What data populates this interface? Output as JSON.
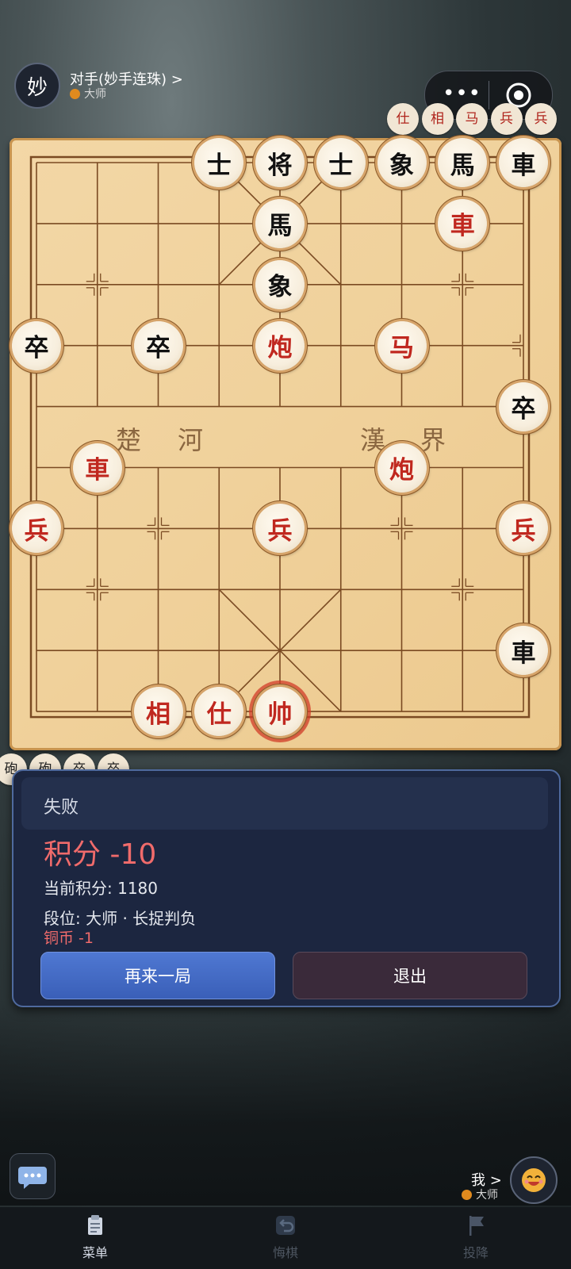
{
  "opponent": {
    "avatar_char": "妙",
    "name": "对手(妙手连珠) >",
    "rank": "大师"
  },
  "capsule": {
    "more_icon": "more-dots-icon",
    "close_icon": "target-close-icon"
  },
  "captured_top": [
    "仕",
    "相",
    "马",
    "兵",
    "兵"
  ],
  "captured_bottom": [
    "砲",
    "砲",
    "卒",
    "卒"
  ],
  "board": {
    "river_left": [
      "楚",
      "河"
    ],
    "river_right": [
      "漢",
      "界"
    ],
    "pieces": [
      {
        "char": "士",
        "color": "black",
        "col": 3,
        "row": 0
      },
      {
        "char": "将",
        "color": "black",
        "col": 4,
        "row": 0
      },
      {
        "char": "士",
        "color": "black",
        "col": 5,
        "row": 0
      },
      {
        "char": "象",
        "color": "black",
        "col": 6,
        "row": 0
      },
      {
        "char": "馬",
        "color": "black",
        "col": 7,
        "row": 0
      },
      {
        "char": "車",
        "color": "black",
        "col": 8,
        "row": 0
      },
      {
        "char": "馬",
        "color": "black",
        "col": 4,
        "row": 1
      },
      {
        "char": "車",
        "color": "red",
        "col": 7,
        "row": 1
      },
      {
        "char": "象",
        "color": "black",
        "col": 4,
        "row": 2
      },
      {
        "char": "卒",
        "color": "black",
        "col": 0,
        "row": 3
      },
      {
        "char": "卒",
        "color": "black",
        "col": 2,
        "row": 3
      },
      {
        "char": "炮",
        "color": "red",
        "col": 4,
        "row": 3
      },
      {
        "char": "马",
        "color": "red",
        "col": 6,
        "row": 3
      },
      {
        "char": "卒",
        "color": "black",
        "col": 8,
        "row": 4
      },
      {
        "char": "車",
        "color": "red",
        "col": 1,
        "row": 5
      },
      {
        "char": "炮",
        "color": "red",
        "col": 6,
        "row": 5
      },
      {
        "char": "兵",
        "color": "red",
        "col": 0,
        "row": 6
      },
      {
        "char": "兵",
        "color": "red",
        "col": 4,
        "row": 6
      },
      {
        "char": "兵",
        "color": "red",
        "col": 8,
        "row": 6
      },
      {
        "char": "車",
        "color": "black",
        "col": 8,
        "row": 8
      },
      {
        "char": "相",
        "color": "red",
        "col": 2,
        "row": 9
      },
      {
        "char": "仕",
        "color": "red",
        "col": 3,
        "row": 9
      },
      {
        "char": "帅",
        "color": "red",
        "col": 4,
        "row": 9,
        "selected": true
      }
    ]
  },
  "result": {
    "title": "失败",
    "score": "积分 -10",
    "current_score": "当前积分: 1180",
    "rank_line": "段位: 大师 · 长捉判负",
    "coin": "铜币 -1",
    "again_label": "再来一局",
    "exit_label": "退出"
  },
  "me": {
    "label": "我 >",
    "rank": "大师",
    "avatar_icon": "smile-face-icon"
  },
  "chat_icon": "chat-bubble-icon",
  "tabs": [
    {
      "label": "菜单",
      "icon": "clipboard-icon",
      "state": "active"
    },
    {
      "label": "悔棋",
      "icon": "undo-icon",
      "state": "disabled"
    },
    {
      "label": "投降",
      "icon": "flag-icon",
      "state": "disabled"
    }
  ],
  "colors": {
    "red_piece": "#c0281f",
    "score_red": "#f06b6b",
    "rank_dot": "#e08a1e",
    "button_blue": "#3a5fb8"
  }
}
